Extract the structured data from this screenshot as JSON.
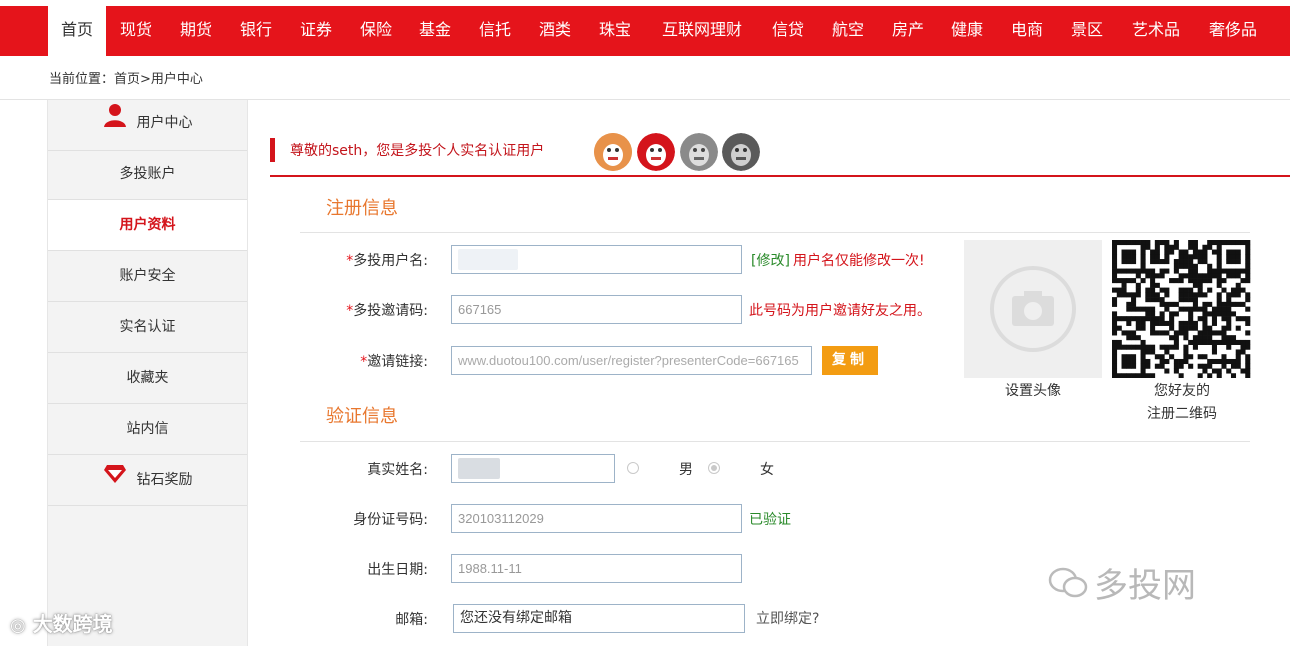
{
  "nav": {
    "items": [
      "首页",
      "现货",
      "期货",
      "银行",
      "证券",
      "保险",
      "基金",
      "信托",
      "酒类",
      "珠宝",
      "互联网理财",
      "信贷",
      "航空",
      "房产",
      "健康",
      "电商",
      "景区",
      "艺术品",
      "奢侈品"
    ],
    "active_index": 0,
    "accent": "#e5141b"
  },
  "breadcrumb": "当前位置：首页>用户中心",
  "sidebar": {
    "header": "用户中心",
    "items": [
      "多投账户",
      "用户资料",
      "账户安全",
      "实名认证",
      "收藏夹",
      "站内信",
      "钻石奖励"
    ],
    "active_index": 1
  },
  "welcome": "尊敬的seth，您是多投个人实名认证用户",
  "sections": {
    "register": "注册信息",
    "verify": "验证信息"
  },
  "register": {
    "username": {
      "required": "*",
      "label": "多投用户名:",
      "value": "",
      "hint_link": "[修改]",
      "hint": "用户名仅能修改一次!"
    },
    "invite_code": {
      "required": "*",
      "label": "多投邀请码:",
      "value": "667165",
      "hint": "此号码为用户邀请好友之用。"
    },
    "invite_link": {
      "required": "*",
      "label": "邀请链接:",
      "value": "www.duotou100.com/user/register?presenterCode=667165",
      "button": "复制"
    }
  },
  "avatar": {
    "caption": "设置头像",
    "icon": "camera-icon"
  },
  "qr": {
    "caption_line1": "您好友的",
    "caption_line2": "注册二维码"
  },
  "verify": {
    "real_name": {
      "label": "真实姓名:",
      "value": ""
    },
    "gender": {
      "male": "男",
      "female": "女",
      "selected": "female"
    },
    "id_number": {
      "label": "身份证号码:",
      "value": "320103112029",
      "status": "已验证"
    },
    "birth_date": {
      "label": "出生日期:",
      "value": "1988.11-11"
    },
    "email": {
      "label": "邮箱:",
      "value": "您还没有绑定邮箱",
      "action": "立即绑定?"
    }
  },
  "watermarks": {
    "right": "多投网",
    "left": "大数跨境"
  }
}
